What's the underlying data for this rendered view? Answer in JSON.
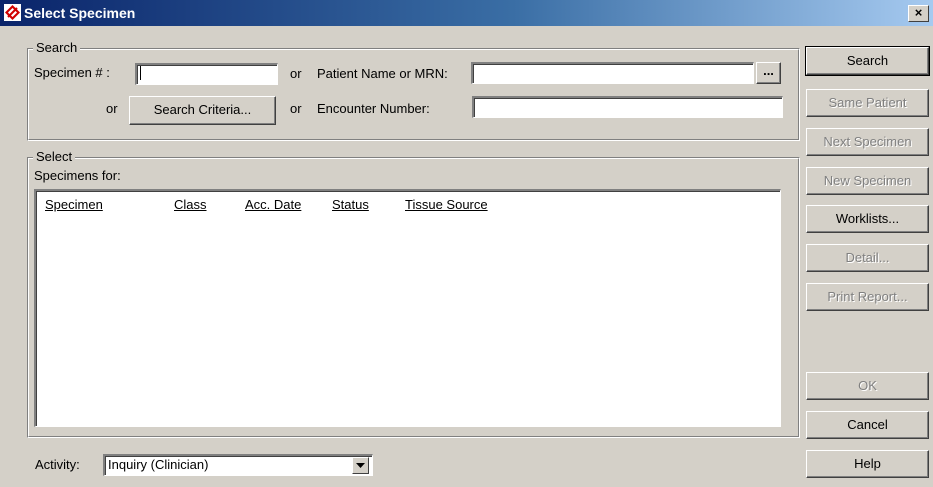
{
  "window": {
    "title": "Select Specimen",
    "close_glyph": "×"
  },
  "search_group": {
    "legend": "Search",
    "specimen_label": "Specimen # :",
    "specimen_value": "",
    "or1": "or",
    "patient_label": "Patient Name or MRN:",
    "patient_value": "",
    "browse_label": "...",
    "or2": "or",
    "criteria_button": "Search Criteria...",
    "or3": "or",
    "encounter_label": "Encounter Number:",
    "encounter_value": ""
  },
  "select_group": {
    "legend": "Select",
    "specimens_for": "Specimens for:",
    "columns": [
      "Specimen",
      "Class",
      "Acc. Date",
      "Status",
      "Tissue Source"
    ],
    "rows": []
  },
  "activity": {
    "label": "Activity:",
    "value": "Inquiry (Clinician)"
  },
  "buttons": {
    "search": "Search",
    "same_patient": "Same Patient",
    "next_specimen": "Next Specimen",
    "new_specimen": "New Specimen",
    "worklists": "Worklists...",
    "detail": "Detail...",
    "print_report": "Print Report...",
    "ok": "OK",
    "cancel": "Cancel",
    "help": "Help"
  },
  "icons": {
    "app": "specimen-app-icon",
    "dropdown": "chevron-down-icon"
  },
  "colors": {
    "titlebar_start": "#0a246a",
    "titlebar_end": "#a6caf0",
    "face": "#d4d0c8"
  }
}
